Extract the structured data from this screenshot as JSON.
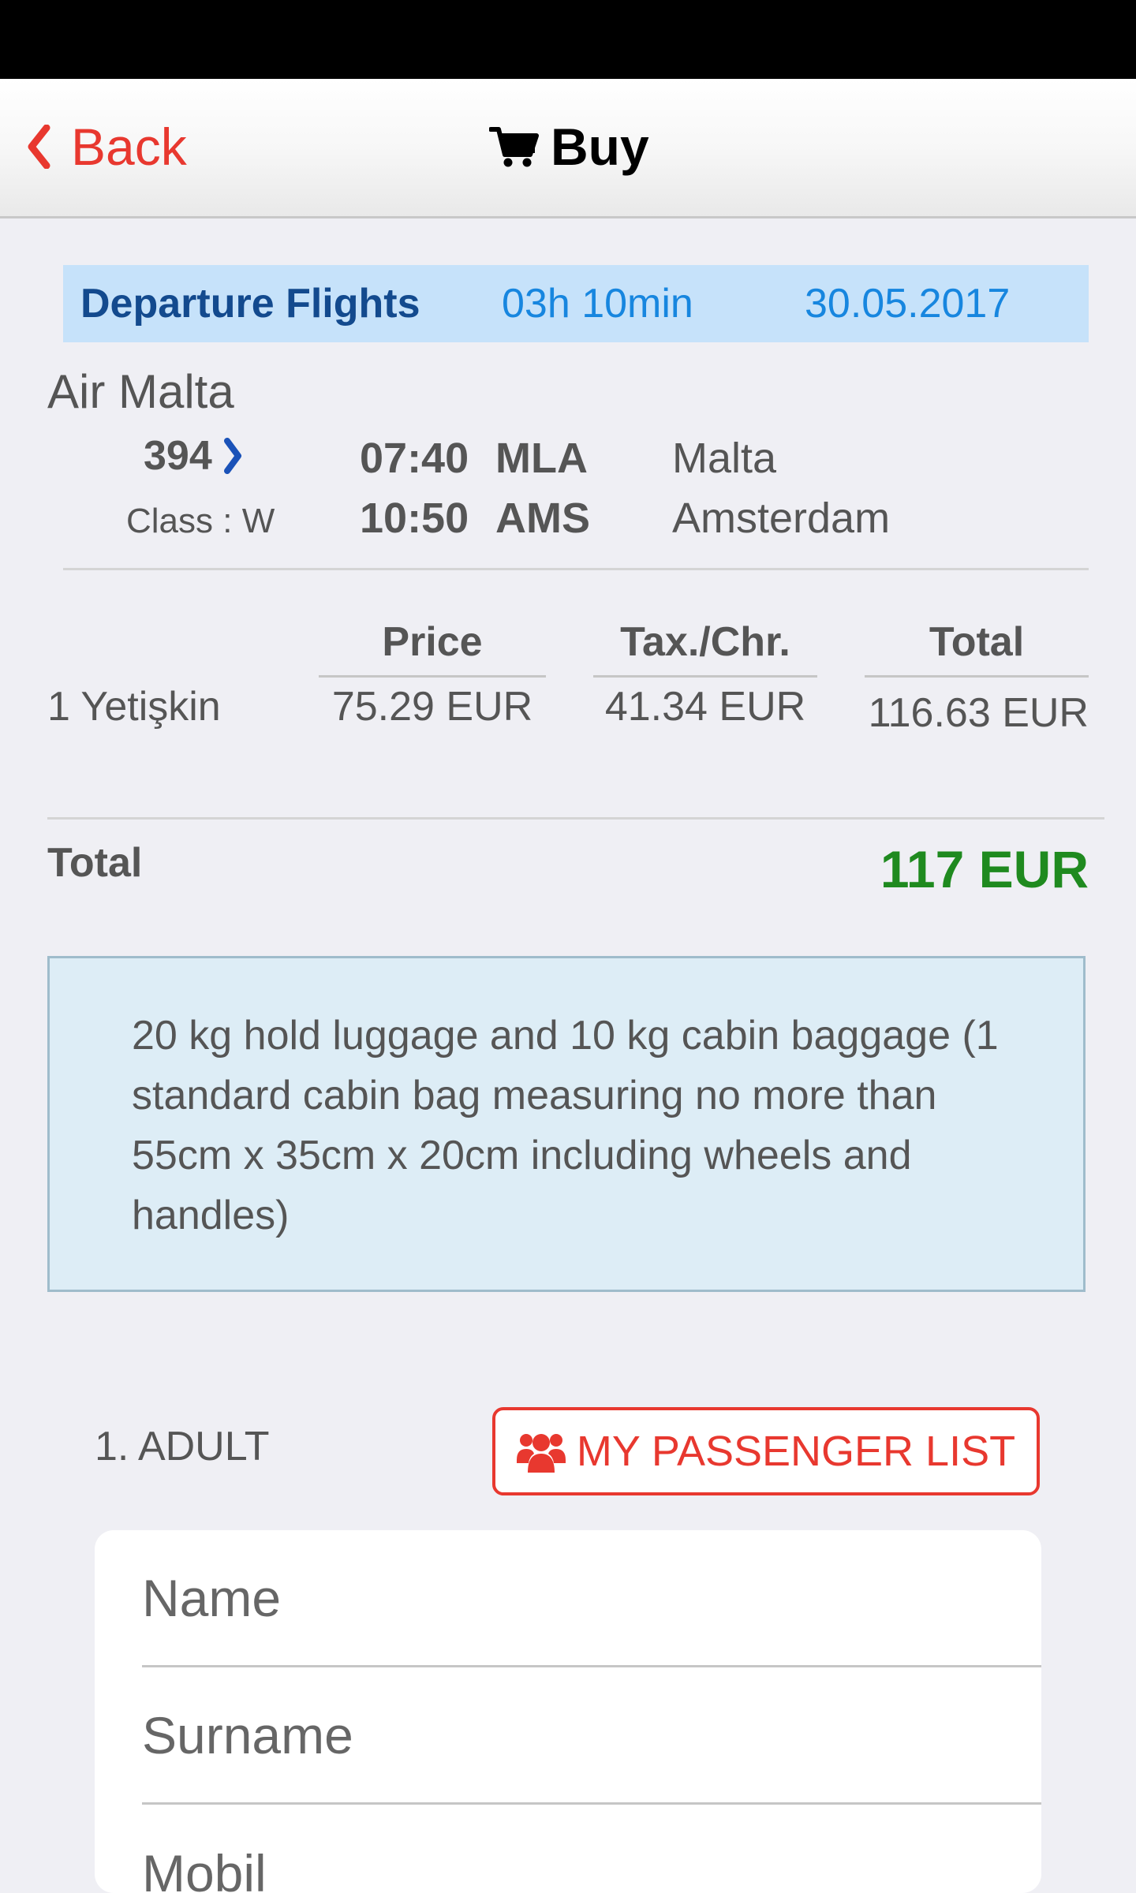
{
  "nav": {
    "back_label": "Back",
    "title": "Buy",
    "back_icon": "chevron-left-icon",
    "title_icon": "cart-icon"
  },
  "colors": {
    "accent_red": "#e8382f",
    "header_blue_bg": "#c6e2fa",
    "header_blue_text": "#134a8e",
    "link_blue": "#1786df",
    "total_green": "#1f8a1f",
    "luggage_bg": "#ddedf6"
  },
  "flight_header": {
    "label": "Departure Flights",
    "duration": "03h 10min",
    "date": "30.05.2017"
  },
  "flight": {
    "airline": "Air Malta",
    "number": "394",
    "class": "Class : W",
    "departure": {
      "time": "07:40",
      "code": "MLA",
      "city": "Malta"
    },
    "arrival": {
      "time": "10:50",
      "code": "AMS",
      "city": "Amsterdam"
    }
  },
  "price_table": {
    "headers": {
      "price": "Price",
      "tax": "Tax./Chr.",
      "total": "Total"
    },
    "row": {
      "passenger_type": "1 Yetişkin",
      "price": "75.29 EUR",
      "tax": "41.34 EUR",
      "total": "116.63 EUR"
    }
  },
  "grand_total": {
    "label": "Total",
    "value": "117 EUR"
  },
  "luggage_info": "20 kg hold luggage and 10 kg cabin baggage (1 standard cabin bag measuring no more than 55cm x 35cm x 20cm including wheels and handles)",
  "passenger": {
    "label": "1. ADULT",
    "list_button": "MY PASSENGER LIST",
    "list_icon": "users-icon",
    "fields": {
      "name_placeholder": "Name",
      "surname_placeholder": "Surname",
      "mobil_placeholder": "Mobil"
    }
  }
}
